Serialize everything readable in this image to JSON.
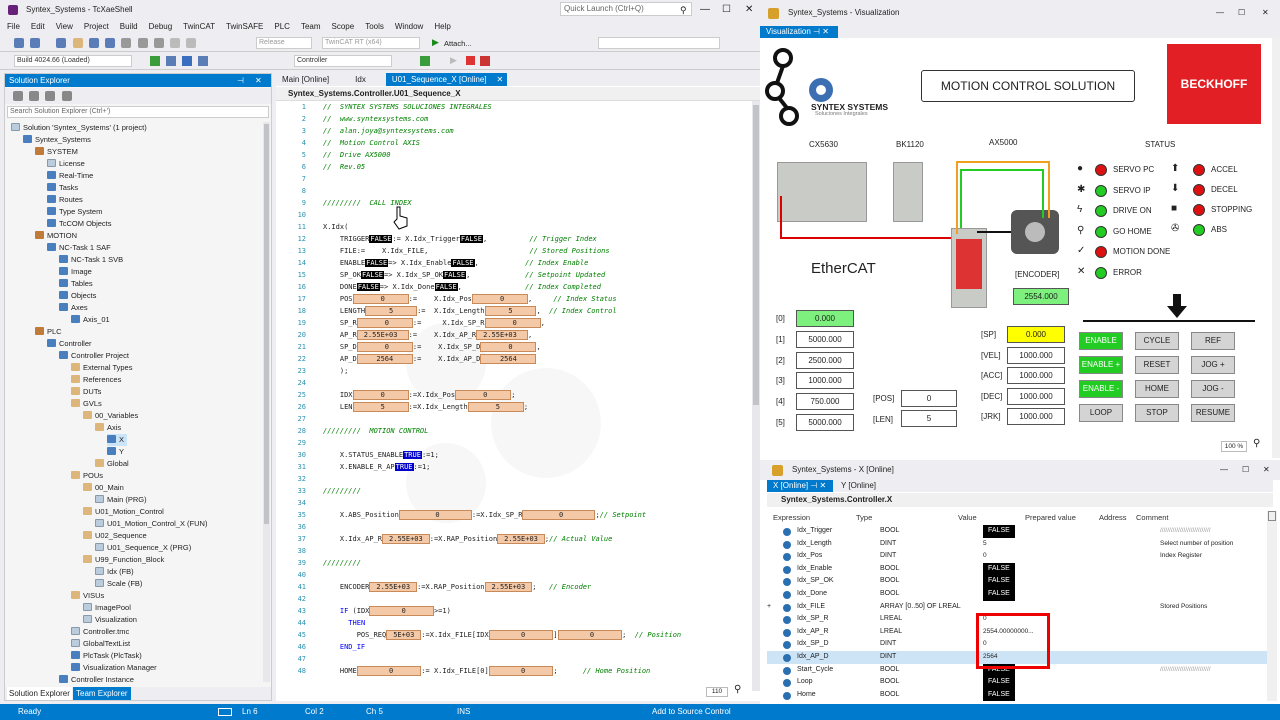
{
  "twincat": {
    "title": "Syntex_Systems - TcXaeShell",
    "quick_launch": "Quick Launch (Ctrl+Q)",
    "menu": [
      "File",
      "Edit",
      "View",
      "Project",
      "Build",
      "Debug",
      "TwinCAT",
      "TwinSAFE",
      "PLC",
      "Team",
      "Scope",
      "Tools",
      "Window",
      "Help"
    ],
    "toolbar": {
      "config": "Release",
      "platform": "TwinCAT RT (x64)",
      "attach": "Attach...",
      "build": "Build 4024.66 (Loaded)",
      "target": "Controller"
    },
    "solution_explorer": {
      "title": "Solution Explorer",
      "search_placeholder": "Search Solution Explorer (Ctrl+')",
      "nodes": [
        {
          "label": "Solution 'Syntex_Systems' (1 project)",
          "indent": 0,
          "icon": "doc"
        },
        {
          "label": "Syntex_Systems",
          "indent": 1,
          "icon": "blue"
        },
        {
          "label": "SYSTEM",
          "indent": 2,
          "icon": "sys"
        },
        {
          "label": "License",
          "indent": 3,
          "icon": "doc"
        },
        {
          "label": "Real-Time",
          "indent": 3,
          "icon": "blue"
        },
        {
          "label": "Tasks",
          "indent": 3,
          "icon": "blue"
        },
        {
          "label": "Routes",
          "indent": 3,
          "icon": "blue"
        },
        {
          "label": "Type System",
          "indent": 3,
          "icon": "blue"
        },
        {
          "label": "TcCOM Objects",
          "indent": 3,
          "icon": "blue"
        },
        {
          "label": "MOTION",
          "indent": 2,
          "icon": "sys"
        },
        {
          "label": "NC-Task 1 SAF",
          "indent": 3,
          "icon": "blue"
        },
        {
          "label": "NC-Task 1 SVB",
          "indent": 4,
          "icon": "blue"
        },
        {
          "label": "Image",
          "indent": 4,
          "icon": "blue"
        },
        {
          "label": "Tables",
          "indent": 4,
          "icon": "blue"
        },
        {
          "label": "Objects",
          "indent": 4,
          "icon": "blue"
        },
        {
          "label": "Axes",
          "indent": 4,
          "icon": "blue"
        },
        {
          "label": "Axis_01",
          "indent": 5,
          "icon": "blue"
        },
        {
          "label": "PLC",
          "indent": 2,
          "icon": "sys"
        },
        {
          "label": "Controller",
          "indent": 3,
          "icon": "blue"
        },
        {
          "label": "Controller Project",
          "indent": 4,
          "icon": "blue"
        },
        {
          "label": "External Types",
          "indent": 5,
          "icon": "fold"
        },
        {
          "label": "References",
          "indent": 5,
          "icon": "fold"
        },
        {
          "label": "DUTs",
          "indent": 5,
          "icon": "fold"
        },
        {
          "label": "GVLs",
          "indent": 5,
          "icon": "fold"
        },
        {
          "label": "00_Variables",
          "indent": 6,
          "icon": "fold"
        },
        {
          "label": "Axis",
          "indent": 7,
          "icon": "fold"
        },
        {
          "label": "X",
          "indent": 8,
          "icon": "blue",
          "selected": true
        },
        {
          "label": "Y",
          "indent": 8,
          "icon": "blue"
        },
        {
          "label": "Global",
          "indent": 7,
          "icon": "fold"
        },
        {
          "label": "POUs",
          "indent": 5,
          "icon": "fold"
        },
        {
          "label": "00_Main",
          "indent": 6,
          "icon": "fold"
        },
        {
          "label": "Main (PRG)",
          "indent": 7,
          "icon": "doc"
        },
        {
          "label": "U01_Motion_Control",
          "indent": 6,
          "icon": "fold"
        },
        {
          "label": "U01_Motion_Control_X (FUN)",
          "indent": 7,
          "icon": "doc"
        },
        {
          "label": "U02_Sequence",
          "indent": 6,
          "icon": "fold"
        },
        {
          "label": "U01_Sequence_X (PRG)",
          "indent": 7,
          "icon": "doc"
        },
        {
          "label": "U99_Function_Block",
          "indent": 6,
          "icon": "fold"
        },
        {
          "label": "Idx (FB)",
          "indent": 7,
          "icon": "doc"
        },
        {
          "label": "Scale (FB)",
          "indent": 7,
          "icon": "doc"
        },
        {
          "label": "VISUs",
          "indent": 5,
          "icon": "fold"
        },
        {
          "label": "ImagePool",
          "indent": 6,
          "icon": "doc"
        },
        {
          "label": "Visualization",
          "indent": 6,
          "icon": "doc"
        },
        {
          "label": "Controller.tmc",
          "indent": 5,
          "icon": "doc"
        },
        {
          "label": "GlobalTextList",
          "indent": 5,
          "icon": "doc"
        },
        {
          "label": "PlcTask (PlcTask)",
          "indent": 5,
          "icon": "blue"
        },
        {
          "label": "Visualization Manager",
          "indent": 5,
          "icon": "blue"
        },
        {
          "label": "Controller Instance",
          "indent": 4,
          "icon": "blue"
        }
      ],
      "bottom_tabs": [
        "Solution Explorer",
        "Team Explorer"
      ]
    },
    "editor": {
      "tabs": [
        "Main [Online]",
        "Idx",
        "U01_Sequence_X [Online]"
      ],
      "path": "Syntex_Systems.Controller.U01_Sequence_X",
      "zoom": "110",
      "lines": [
        {
          "n": "1",
          "html": "<span class='cm'>//  SYNTEX SYSTEMS SOLUCIONES INTEGRALES</span>"
        },
        {
          "n": "2",
          "html": "<span class='cm'>//  www.syntexsystems.com</span>"
        },
        {
          "n": "3",
          "html": "<span class='cm'>//  alan.joya@syntexsystems.com</span>"
        },
        {
          "n": "4",
          "html": "<span class='cm'>//  Motion Control AXIS</span>"
        },
        {
          "n": "5",
          "html": "<span class='cm'>//  Drive AX5000</span>"
        },
        {
          "n": "6",
          "html": "<span class='cm'>//  Rev.05</span>"
        },
        {
          "n": "7",
          "html": ""
        },
        {
          "n": "8",
          "html": ""
        },
        {
          "n": "9",
          "html": "<span class='cm'>/////////  CALL INDEX</span>"
        },
        {
          "n": "10",
          "html": ""
        },
        {
          "n": "11",
          "html": "X.Idx("
        },
        {
          "n": "12",
          "html": "    TRIGGER<span class='fb'>FALSE</span>:= X.Idx_Trigger<span class='fb'>FALSE</span>,          <span class='cm'>// Trigger Index</span>"
        },
        {
          "n": "13",
          "html": "    FILE:=    X.Idx_FILE,                        <span class='cm'>// Stored Positions</span>"
        },
        {
          "n": "14",
          "html": "    ENABLE<span class='fb'>FALSE</span>=> X.Idx_Enable<span class='fb'>FALSE</span>,           <span class='cm'>// Index Enable</span>"
        },
        {
          "n": "15",
          "html": "    SP_OK<span class='fb'>FALSE</span>=> X.Idx_SP_OK<span class='fb'>FALSE</span>,             <span class='cm'>// Setpoint Updated</span>"
        },
        {
          "n": "16",
          "html": "    DONE<span class='fb'>FALSE</span>=> X.Idx_Done<span class='fb'>FALSE</span>,               <span class='cm'>// Index Completed</span>"
        },
        {
          "n": "17",
          "html": "    POS<span class='vb'>     0    </span>:=    X.Idx_Pos<span class='vb'>     0    </span>,     <span class='cm'>// Index Status</span>"
        },
        {
          "n": "18",
          "html": "    LENGTH<span class='vb'>    5    </span>:=  X.Idx_Length<span class='vb'>    5    </span>,  <span class='cm'>// Index Control</span>"
        },
        {
          "n": "19",
          "html": "    SP_R<span class='vb'>     0    </span>:=     X.Idx_SP_R<span class='vb'>     0    </span>,"
        },
        {
          "n": "20",
          "html": "    AP_R<span class='vb'>2.55E+03 </span>:=    X.Idx_AP_R<span class='vb'>2.55E+03 </span>,"
        },
        {
          "n": "21",
          "html": "    SP_D<span class='vb'>     0    </span>:=    X.Idx_SP_D<span class='vb'>     0    </span>,"
        },
        {
          "n": "22",
          "html": "    AP_D<span class='vb'>   2564   </span>:=    X.Idx_AP_D<span class='vb'>   2564   </span>"
        },
        {
          "n": "23",
          "html": "    );"
        },
        {
          "n": "24",
          "html": ""
        },
        {
          "n": "25",
          "html": "    IDX<span class='vb'>     0    </span>:=X.Idx_Pos<span class='vb'>     0    </span>;"
        },
        {
          "n": "26",
          "html": "    LEN<span class='vb'>     5    </span>:=X.Idx_Length<span class='vb'>     5    </span>;"
        },
        {
          "n": "27",
          "html": ""
        },
        {
          "n": "28",
          "html": "<span class='cm'>/////////  MOTION CONTROL</span>"
        },
        {
          "n": "29",
          "html": ""
        },
        {
          "n": "30",
          "html": "    X.STATUS_ENABLE<span class='tb'>TRUE</span>:=1;"
        },
        {
          "n": "31",
          "html": "    X.ENABLE_R_AP<span class='tb'>TRUE</span>:=1;"
        },
        {
          "n": "32",
          "html": ""
        },
        {
          "n": "33",
          "html": "<span class='cm'>/////////</span>"
        },
        {
          "n": "34",
          "html": ""
        },
        {
          "n": "35",
          "html": "    X.ABS_Position<span class='vb'>       0      </span>:=X.Idx_SP_R<span class='vb'>       0      </span>;<span class='cm'>// Setpoint</span>"
        },
        {
          "n": "36",
          "html": ""
        },
        {
          "n": "37",
          "html": "    X.Idx_AP_R<span class='vb'>2.55E+03</span>:=X.RAP_Position<span class='vb'>2.55E+03</span>;<span class='cm'>// Actual Value</span>"
        },
        {
          "n": "38",
          "html": ""
        },
        {
          "n": "39",
          "html": "<span class='cm'>/////////</span>"
        },
        {
          "n": "40",
          "html": ""
        },
        {
          "n": "41",
          "html": "    ENCODER<span class='vb'>2.55E+03</span>:=X.RAP_Position<span class='vb'>2.55E+03</span>;   <span class='cm'>// Encoder</span>"
        },
        {
          "n": "42",
          "html": ""
        },
        {
          "n": "43",
          "html": "    <span class='kw'>IF</span> (IDX<span class='vb'>      0     </span>&gt;=1)"
        },
        {
          "n": "44",
          "html": "      <span class='kw'>THEN</span>"
        },
        {
          "n": "45",
          "html": "        POS_REQ<span class='vb'>5E+03</span>:=X.Idx_FILE[IDX<span class='vb'>      0     </span>]<span class='vb'>      0     </span>;  <span class='cm'>// Position</span>"
        },
        {
          "n": "46",
          "html": "    <span class='kw'>END_IF</span>"
        },
        {
          "n": "47",
          "html": ""
        },
        {
          "n": "48",
          "html": "    HOME<span class='vb'>      0     </span>:= X.Idx_FILE[0]<span class='vb'>      0     </span>;      <span class='cm'>// Home Position</span>"
        }
      ]
    },
    "status": {
      "ready": "Ready",
      "ln": "Ln 6",
      "col": "Col 2",
      "ch": "Ch 5",
      "ins": "INS",
      "source": "Add to Source Control"
    }
  },
  "visualization": {
    "window_title": "Syntex_Systems - Visualization",
    "tab": "Visualization",
    "brand": "SYNTEX SYSTEMS",
    "brand_sub": "Soluciones Integrales",
    "header": "MOTION CONTROL SOLUTION",
    "logo": "BECKHOFF",
    "devices": [
      "CX5630",
      "BK1120",
      "AX5000"
    ],
    "ethercat": "EtherCAT",
    "encoder_label": "[ENCODER]",
    "encoder_value": "2554.000",
    "status_title": "STATUS",
    "status_left": [
      {
        "label": "SERVO PC",
        "led": "red",
        "icon": "●"
      },
      {
        "label": "SERVO IP",
        "led": "grn",
        "icon": "✱"
      },
      {
        "label": "DRIVE ON",
        "led": "grn",
        "icon": "ϟ"
      },
      {
        "label": "GO HOME",
        "led": "grn",
        "icon": "⚲"
      },
      {
        "label": "MOTION DONE",
        "led": "red",
        "icon": "✓"
      },
      {
        "label": "ERROR",
        "led": "grn",
        "icon": "✕"
      }
    ],
    "status_right": [
      {
        "label": "ACCEL",
        "led": "red",
        "icon": "⬆"
      },
      {
        "label": "DECEL",
        "led": "red",
        "icon": "⬇"
      },
      {
        "label": "STOPPING",
        "led": "red",
        "icon": "■"
      },
      {
        "label": "ABS",
        "led": "grn",
        "icon": "✇"
      }
    ],
    "positions": [
      {
        "idx": "[0]",
        "value": "0.000",
        "green": true
      },
      {
        "idx": "[1]",
        "value": "5000.000"
      },
      {
        "idx": "[2]",
        "value": "2500.000"
      },
      {
        "idx": "[3]",
        "value": "1000.000"
      },
      {
        "idx": "[4]",
        "value": "750.000"
      },
      {
        "idx": "[5]",
        "value": "5000.000"
      }
    ],
    "pos_label": "[POS]",
    "pos_value": "0",
    "len_label": "[LEN]",
    "len_value": "5",
    "params": [
      {
        "label": "[SP]",
        "value": "0.000",
        "yellow": true
      },
      {
        "label": "[VEL]",
        "value": "1000.000"
      },
      {
        "label": "[ACC]",
        "value": "1000.000"
      },
      {
        "label": "[DEC]",
        "value": "1000.000"
      },
      {
        "label": "[JRK]",
        "value": "1000.000"
      }
    ],
    "buttons": [
      [
        "ENABLE",
        "CYCLE",
        "REF"
      ],
      [
        "ENABLE +",
        "RESET",
        "JOG +"
      ],
      [
        "ENABLE -",
        "HOME",
        "JOG -"
      ],
      [
        "LOOP",
        "STOP",
        "RESUME"
      ]
    ],
    "zoom": "100 %"
  },
  "watch": {
    "window_title": "Syntex_Systems - X [Online]",
    "tabs": [
      "X [Online]",
      "Y [Online]"
    ],
    "path": "Syntex_Systems.Controller.X",
    "columns": [
      "Expression",
      "Type",
      "Value",
      "Prepared value",
      "Address",
      "Comment"
    ],
    "rows": [
      {
        "expr": "Idx_Trigger",
        "type": "BOOL",
        "value": "FALSE",
        "bool": true,
        "comment": "////////////////////////////"
      },
      {
        "expr": "Idx_Length",
        "type": "DINT",
        "value": "5",
        "comment": "Select number of position"
      },
      {
        "expr": "Idx_Pos",
        "type": "DINT",
        "value": "0",
        "comment": "Index Register"
      },
      {
        "expr": "Idx_Enable",
        "type": "BOOL",
        "value": "FALSE",
        "bool": true,
        "comment": ""
      },
      {
        "expr": "Idx_SP_OK",
        "type": "BOOL",
        "value": "FALSE",
        "bool": true,
        "comment": ""
      },
      {
        "expr": "Idx_Done",
        "type": "BOOL",
        "value": "FALSE",
        "bool": true,
        "comment": ""
      },
      {
        "expr": "Idx_FILE",
        "type": "ARRAY [0..50] OF LREAL",
        "value": "",
        "comment": "Stored Positions",
        "expand": true
      },
      {
        "expr": "Idx_SP_R",
        "type": "LREAL",
        "value": "0",
        "comment": ""
      },
      {
        "expr": "Idx_AP_R",
        "type": "LREAL",
        "value": "2554.00000000...",
        "comment": ""
      },
      {
        "expr": "Idx_SP_D",
        "type": "DINT",
        "value": "0",
        "comment": ""
      },
      {
        "expr": "Idx_AP_D",
        "type": "DINT",
        "value": "2564",
        "comment": "",
        "selected": true
      },
      {
        "expr": "Start_Cycle",
        "type": "BOOL",
        "value": "FALSE",
        "bool": true,
        "comment": "////////////////////////////"
      },
      {
        "expr": "Loop",
        "type": "BOOL",
        "value": "FALSE",
        "bool": true,
        "comment": ""
      },
      {
        "expr": "Home",
        "type": "BOOL",
        "value": "FALSE",
        "bool": true,
        "comment": ""
      }
    ]
  },
  "colors": {
    "accent": "#007acc",
    "bool_bg": "#000000",
    "var_bg": "#f4c9a8",
    "led_red": "#dd1111",
    "led_green": "#22cc22",
    "highlight": "#ee0000"
  }
}
